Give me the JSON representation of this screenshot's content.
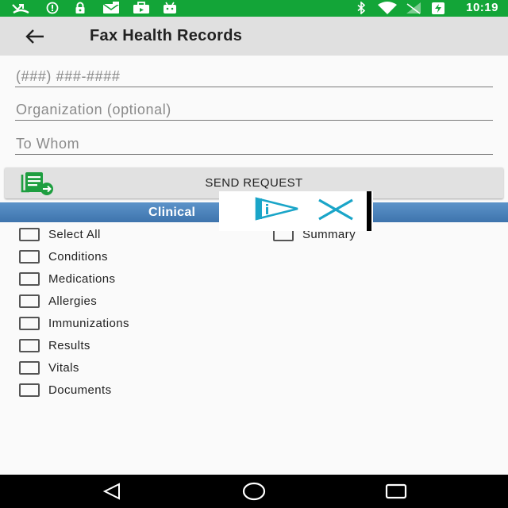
{
  "status_bar": {
    "time": "10:19",
    "left_icons": [
      "missed-call-icon",
      "sync-icon",
      "lock-icon",
      "mail-icon",
      "briefcase-icon",
      "android-icon"
    ],
    "right_icons": [
      "bluetooth-icon",
      "wifi-icon",
      "no-signal-icon",
      "battery-charging-icon"
    ],
    "color": "#13a538"
  },
  "toolbar": {
    "title": "Fax Health Records",
    "back_icon": "back-arrow-icon"
  },
  "form": {
    "fax_number": {
      "placeholder": "(###) ###-####",
      "value": ""
    },
    "organization": {
      "placeholder": "Organization (optional)",
      "value": ""
    },
    "to_whom": {
      "placeholder": "To Whom",
      "value": ""
    }
  },
  "send_button": {
    "label": "SEND REQUEST",
    "icon": "fax-send-icon"
  },
  "section": {
    "title": "Clinical",
    "color": "#4a82bd"
  },
  "checklist": {
    "left": [
      {
        "label": "Select All",
        "checked": false
      },
      {
        "label": "Conditions",
        "checked": false
      },
      {
        "label": "Medications",
        "checked": false
      },
      {
        "label": "Allergies",
        "checked": false
      },
      {
        "label": "Immunizations",
        "checked": false
      },
      {
        "label": "Results",
        "checked": false
      },
      {
        "label": "Vitals",
        "checked": false
      },
      {
        "label": "Documents",
        "checked": false
      }
    ],
    "right": [
      {
        "label": "Summary",
        "checked": false
      }
    ]
  },
  "ad_overlay": {
    "icons": [
      "ad-choices-icon",
      "close-icon"
    ],
    "color": "#1aa5c8"
  },
  "nav_bar": {
    "buttons": [
      "back-triangle-icon",
      "home-circle-icon",
      "recents-square-icon"
    ]
  }
}
